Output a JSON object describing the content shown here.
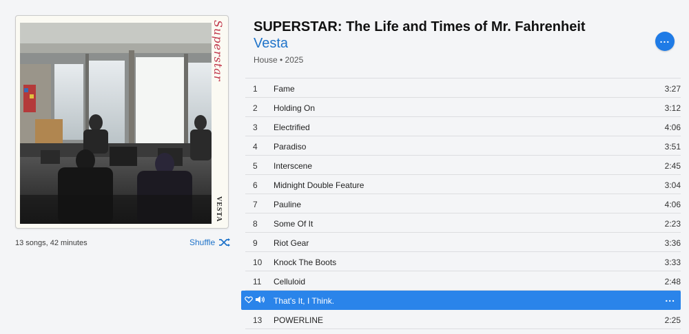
{
  "album": {
    "title": "SUPERSTAR: The Life and Times of Mr. Fahrenheit",
    "artist": "Vesta",
    "genre_year": "House • 2025",
    "summary": "13 songs, 42 minutes",
    "shuffle_label": "Shuffle",
    "artwork": {
      "side_title": "Superstar",
      "side_brand": "VESTA"
    }
  },
  "colors": {
    "accent": "#1f73c9",
    "active_row": "#2a84ea"
  },
  "tracks": [
    {
      "num": "1",
      "title": "Fame",
      "duration": "3:27"
    },
    {
      "num": "2",
      "title": "Holding On",
      "duration": "3:12"
    },
    {
      "num": "3",
      "title": "Electrified",
      "duration": "4:06"
    },
    {
      "num": "4",
      "title": "Paradiso",
      "duration": "3:51"
    },
    {
      "num": "5",
      "title": "Interscene",
      "duration": "2:45"
    },
    {
      "num": "6",
      "title": "Midnight Double Feature",
      "duration": "3:04"
    },
    {
      "num": "7",
      "title": "Pauline",
      "duration": "4:06"
    },
    {
      "num": "8",
      "title": "Some Of It",
      "duration": "2:23"
    },
    {
      "num": "9",
      "title": "Riot Gear",
      "duration": "3:36"
    },
    {
      "num": "10",
      "title": "Knock The Boots",
      "duration": "3:33"
    },
    {
      "num": "11",
      "title": "Celluloid",
      "duration": "2:48"
    },
    {
      "num": "",
      "title": "That's It, I Think.",
      "duration": "",
      "playing": true
    },
    {
      "num": "13",
      "title": "POWERLINE",
      "duration": "2:25"
    }
  ]
}
